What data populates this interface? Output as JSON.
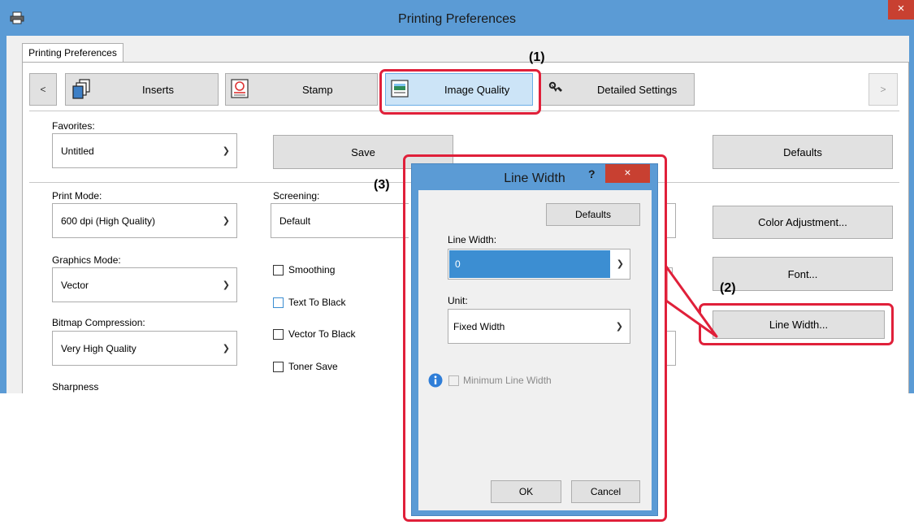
{
  "window": {
    "title": "Printing Preferences",
    "close": "×"
  },
  "tab": {
    "label": "Printing Preferences"
  },
  "toolbar": {
    "prev": "<",
    "next": ">",
    "inserts": "Inserts",
    "stamp": "Stamp",
    "image_quality": "Image Quality",
    "detailed_settings": "Detailed Settings"
  },
  "favorites": {
    "label": "Favorites:",
    "value": "Untitled",
    "save": "Save",
    "defaults": "Defaults"
  },
  "print_mode": {
    "label": "Print Mode:",
    "value": "600 dpi (High Quality)"
  },
  "screening": {
    "label": "Screening:",
    "value": "Default"
  },
  "graphics_mode": {
    "label": "Graphics Mode:",
    "value": "Vector"
  },
  "bitmap_compression": {
    "label": "Bitmap Compression:",
    "value": "Very High Quality"
  },
  "sharpness": {
    "label": "Sharpness"
  },
  "checkboxes": {
    "smoothing": "Smoothing",
    "text_to_black": "Text To Black",
    "vector_to_black": "Vector To Black",
    "toner_save": "Toner Save"
  },
  "side_buttons": {
    "color_adjustment": "Color Adjustment...",
    "font": "Font...",
    "line_width": "Line Width..."
  },
  "callouts": {
    "one": "(1)",
    "two": "(2)",
    "three": "(3)"
  },
  "dialog": {
    "title": "Line Width",
    "help": "?",
    "close": "×",
    "defaults": "Defaults",
    "line_width_label": "Line Width:",
    "line_width_value": "0",
    "unit_label": "Unit:",
    "unit_value": "Fixed Width",
    "min_line_width": "Minimum Line Width",
    "ok": "OK",
    "cancel": "Cancel"
  },
  "icons": {
    "app": "printer-icon",
    "inserts": "inserts-icon",
    "stamp": "stamp-icon",
    "image_quality": "image-quality-icon",
    "detailed_settings": "wrench-icon",
    "info": "info-icon"
  },
  "colors": {
    "title_bar": "#5b9bd5",
    "close_button": "#c84031",
    "selected_tab": "#cce4f7",
    "highlight_field": "#3c8ed2",
    "callout_red": "#e0203a"
  }
}
